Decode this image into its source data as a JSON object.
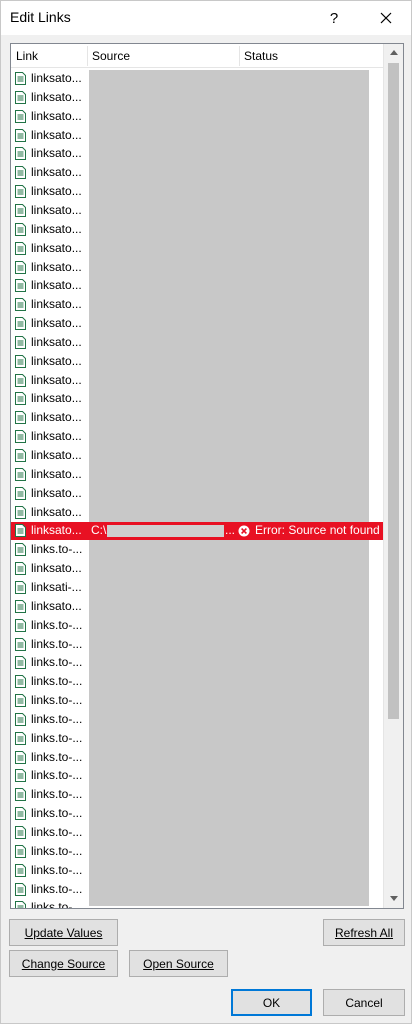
{
  "window": {
    "title": "Edit Links",
    "help_label": "?"
  },
  "columns": {
    "link": "Link",
    "source": "Source",
    "status": "Status"
  },
  "rows": [
    "linksato...",
    "linksato...",
    "linksato...",
    "linksato...",
    "linksato...",
    "linksato...",
    "linksato...",
    "linksato...",
    "linksato...",
    "linksato...",
    "linksato...",
    "linksato...",
    "linksato...",
    "linksato...",
    "linksato...",
    "linksato...",
    "linksato...",
    "linksato...",
    "linksato...",
    "linksato...",
    "linksato...",
    "linksato...",
    "linksato...",
    "linksato...",
    "linksato...",
    "links.to-...",
    "linksato...",
    "linksati-...",
    "linksato...",
    "links.to-...",
    "links.to-...",
    "links.to-...",
    "links.to-...",
    "links.to-...",
    "links.to-...",
    "links.to-...",
    "links.to-...",
    "links.to-...",
    "links.to-...",
    "links.to-...",
    "links.to-...",
    "links.to-...",
    "links.to-...",
    "links.to-...",
    "links.to-...",
    "links.to-...",
    "links.to-..."
  ],
  "selected_index": 24,
  "selected_row": {
    "link": "linksato...",
    "source_prefix": "C:\\",
    "source_suffix": "...",
    "status": "Error: Source not found"
  },
  "buttons": {
    "update_values": "Update Values",
    "change_source": "Change Source",
    "open_source": "Open Source",
    "refresh_all": "Refresh All",
    "ok": "OK",
    "cancel": "Cancel"
  },
  "colors": {
    "selected_row": "#e81123",
    "accent": "#0078d7"
  }
}
